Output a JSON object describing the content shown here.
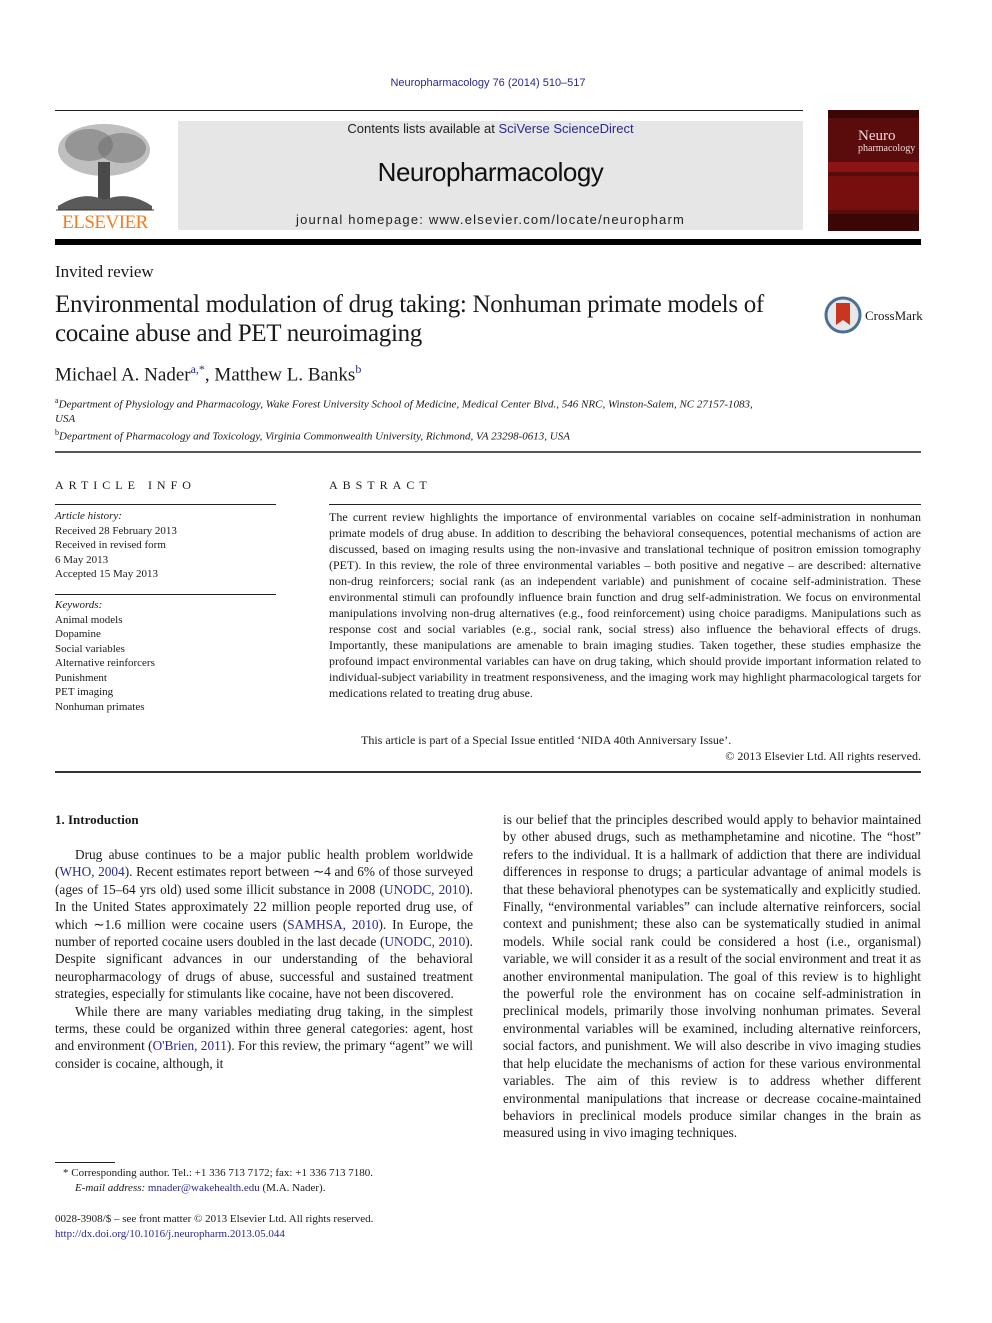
{
  "header": {
    "citation": "Neuropharmacology 76 (2014) 510–517",
    "contents_prefix": "Contents lists available at ",
    "contents_link": "SciVerse ScienceDirect",
    "journal_title": "Neuropharmacology",
    "homepage": "journal homepage: www.elsevier.com/locate/neuropharm",
    "publisher_wordmark": "ELSEVIER",
    "cover_title_line1": "Neuro",
    "cover_title_line2": "pharmacology",
    "colors": {
      "publisher_orange": "#f47c1f",
      "link_blue": "#2a2a8c",
      "cover_red": "#5a0c0c",
      "header_gray": "#e6e6e6"
    }
  },
  "article": {
    "type": "Invited review",
    "title": "Environmental modulation of drug taking: Nonhuman primate models of cocaine abuse and PET neuroimaging",
    "crossmark_label": "CrossMark",
    "authors": [
      {
        "name": "Michael A. Nader",
        "sup": "a,*"
      },
      {
        "name": "Matthew L. Banks",
        "sup": "b"
      }
    ],
    "author_separator": ", ",
    "affiliations": [
      {
        "sup": "a",
        "text": "Department of Physiology and Pharmacology, Wake Forest University School of Medicine, Medical Center Blvd., 546 NRC, Winston-Salem, NC 27157-1083, USA"
      },
      {
        "sup": "b",
        "text": "Department of Pharmacology and Toxicology, Virginia Commonwealth University, Richmond, VA 23298-0613, USA"
      }
    ]
  },
  "article_info": {
    "heading": "ARTICLE INFO",
    "history_label": "Article history:",
    "history": [
      "Received 28 February 2013",
      "Received in revised form",
      "6 May 2013",
      "Accepted 15 May 2013"
    ],
    "keywords_label": "Keywords:",
    "keywords": [
      "Animal models",
      "Dopamine",
      "Social variables",
      "Alternative reinforcers",
      "Punishment",
      "PET imaging",
      "Nonhuman primates"
    ]
  },
  "abstract": {
    "heading": "ABSTRACT",
    "body": "The current review highlights the importance of environmental variables on cocaine self-administration in nonhuman primate models of drug abuse. In addition to describing the behavioral consequences, potential mechanisms of action are discussed, based on imaging results using the non-invasive and translational technique of positron emission tomography (PET). In this review, the role of three environmental variables – both positive and negative – are described: alternative non-drug reinforcers; social rank (as an independent variable) and punishment of cocaine self-administration. These environmental stimuli can profoundly influence brain function and drug self-administration. We focus on environmental manipulations involving non-drug alternatives (e.g., food reinforcement) using choice paradigms. Manipulations such as response cost and social variables (e.g., social rank, social stress) also influence the behavioral effects of drugs. Importantly, these manipulations are amenable to brain imaging studies. Taken together, these studies emphasize the profound impact environmental variables can have on drug taking, which should provide important information related to individual-subject variability in treatment responsiveness, and the imaging work may highlight pharmacological targets for medications related to treating drug abuse.",
    "special_issue": "This article is part of a Special Issue entitled ‘NIDA 40th Anniversary Issue’.",
    "copyright": "© 2013 Elsevier Ltd. All rights reserved."
  },
  "introduction": {
    "heading": "1.  Introduction",
    "p1": [
      {
        "t": "Drug abuse continues to be a major public health problem worldwide ("
      },
      {
        "link": "WHO, 2004"
      },
      {
        "t": "). Recent estimates report between ∼4 and 6% of those surveyed (ages of 15–64 yrs old) used some illicit substance in 2008 ("
      },
      {
        "link": "UNODC, 2010"
      },
      {
        "t": "). In the United States approximately 22 million people reported drug use, of which ∼1.6 million were cocaine users ("
      },
      {
        "link": "SAMHSA, 2010"
      },
      {
        "t": "). In Europe, the number of reported cocaine users doubled in the last decade ("
      },
      {
        "link": "UNODC, 2010"
      },
      {
        "t": "). Despite significant advances in our understanding of the behavioral neuropharmacology of drugs of abuse, successful and sustained treatment strategies, especially for stimulants like cocaine, have not been discovered."
      }
    ],
    "p2": [
      {
        "t": "While there are many variables mediating drug taking, in the simplest terms, these could be organized within three general categories: agent, host and environment ("
      },
      {
        "link": "O'Brien, 2011"
      },
      {
        "t": "). For this review, the primary “agent” we will consider is cocaine, although, it"
      }
    ],
    "right_column": "is our belief that the principles described would apply to behavior maintained by other abused drugs, such as methamphetamine and nicotine. The “host” refers to the individual. It is a hallmark of addiction that there are individual differences in response to drugs; a particular advantage of animal models is that these behavioral phenotypes can be systematically and explicitly studied. Finally, “environmental variables” can include alternative reinforcers, social context and punishment; these also can be systematically studied in animal models. While social rank could be considered a host (i.e., organismal) variable, we will consider it as a result of the social environment and treat it as another environmental manipulation. The goal of this review is to highlight the powerful role the environment has on cocaine self-administration in preclinical models, primarily those involving nonhuman primates. Several environmental variables will be examined, including alternative reinforcers, social factors, and punishment. We will also describe in vivo imaging studies that help elucidate the mechanisms of action for these various environmental variables. The aim of this review is to address whether different environmental manipulations that increase or decrease cocaine-maintained behaviors in preclinical models produce similar changes in the brain as measured using in vivo imaging techniques."
  },
  "footnote": {
    "corresponding": "* Corresponding author. Tel.: +1 336 713 7172; fax: +1 336 713 7180.",
    "email_label": "E-mail address:",
    "email": "mnader@wakehealth.edu",
    "email_suffix": " (M.A. Nader).",
    "front_matter": "0028-3908/$ – see front matter © 2013 Elsevier Ltd. All rights reserved.",
    "doi": "http://dx.doi.org/10.1016/j.neuropharm.2013.05.044"
  }
}
